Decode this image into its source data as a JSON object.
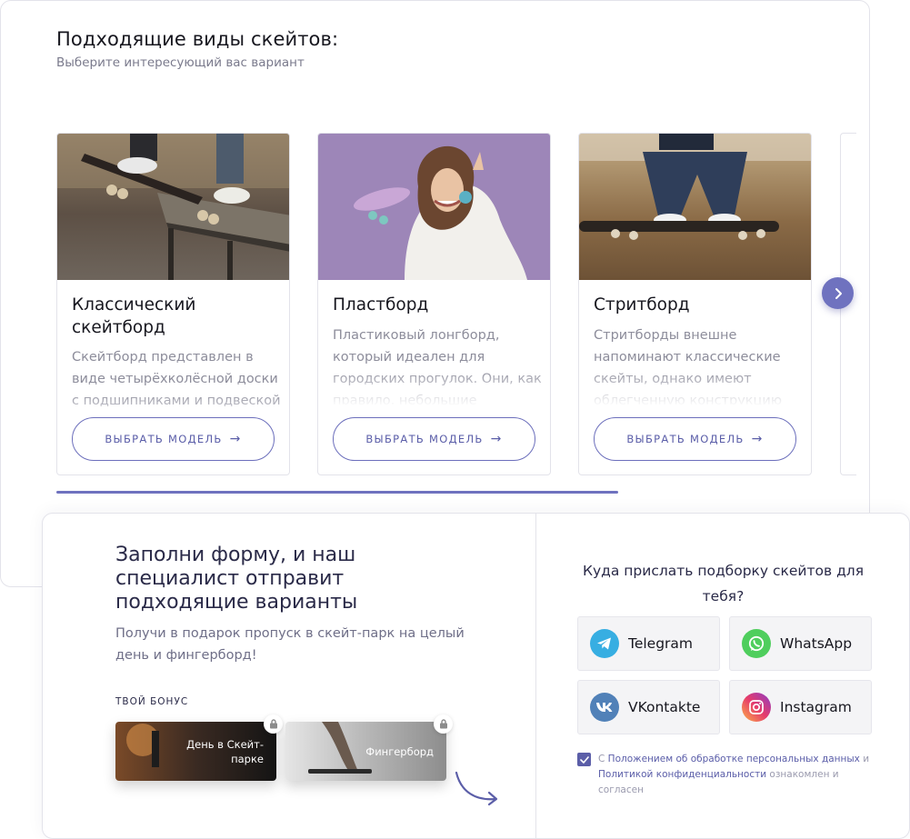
{
  "header": {
    "title": "Подходящие виды скейтов:",
    "subtitle": "Выберите интересующий вас вариант"
  },
  "cards": [
    {
      "title": "Классический скейтборд",
      "description": "Скейтборд представлен в виде четырёхколёсной доски с подшипниками и подвеской",
      "button_label": "ВЫБРАТЬ МОДЕЛЬ"
    },
    {
      "title": "Пластборд",
      "description": "Пластиковый лонгборд, который идеален для городских прогулок. Они, как правило, небольшие",
      "button_label": "ВЫБРАТЬ МОДЕЛЬ"
    },
    {
      "title": "Стритборд",
      "description": "Стритборды внешне напоминают классические скейты, однако имеют облегченную конструкцию",
      "button_label": "ВЫБРАТЬ МОДЕЛЬ"
    }
  ],
  "carousel": {
    "next_icon": "chevron-right-icon"
  },
  "form": {
    "title": "Заполни форму, и наш специалист отправит подходящие варианты",
    "subtitle": "Получи в подарок пропуск в скейт-парк на целый день и фингерборд!",
    "bonus_label": "ТВОЙ БОНУС",
    "bonuses": [
      {
        "label": "День в Скейт-парке",
        "icon": "lock-icon"
      },
      {
        "label": "Фингерборд",
        "icon": "lock-icon"
      }
    ]
  },
  "contact": {
    "question": "Куда прислать подборку скейтов для тебя?",
    "messengers": [
      {
        "name": "Telegram",
        "icon": "telegram-icon",
        "color": "#37aee2"
      },
      {
        "name": "WhatsApp",
        "icon": "whatsapp-icon",
        "color": "#4fce5d"
      },
      {
        "name": "VKontakte",
        "icon": "vk-icon",
        "color": "#5181b8"
      },
      {
        "name": "Instagram",
        "icon": "instagram-icon",
        "color": "#d6249f"
      }
    ],
    "consent": {
      "checked": true,
      "prefix": "С ",
      "link1": "Положением об обработке персональных данных",
      "middle": " и ",
      "link2": "Политикой конфиденциальности",
      "suffix": " ознакомлен и согласен"
    }
  },
  "colors": {
    "accent": "#6f72bf",
    "text_muted": "#8d8d9b"
  }
}
